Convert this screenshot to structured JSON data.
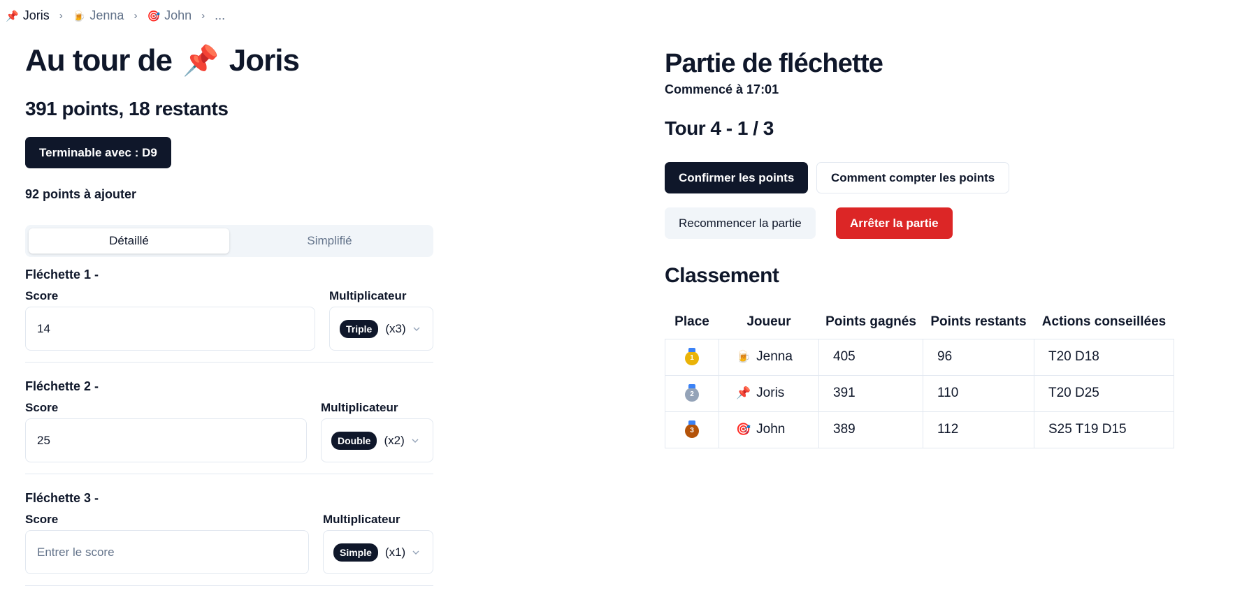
{
  "breadcrumb": [
    {
      "emoji": "📌",
      "name": "Joris",
      "current": true
    },
    {
      "emoji": "🍺",
      "name": "Jenna",
      "current": false
    },
    {
      "emoji": "🎯",
      "name": "John",
      "current": false
    },
    {
      "emoji": "",
      "name": "...",
      "current": false
    }
  ],
  "turn": {
    "prefix": "Au tour de",
    "emoji": "📌",
    "player": "Joris",
    "points_line": "391 points, 18 restants",
    "finish_button": "Terminable avec : D9",
    "to_add": "92 points à ajouter"
  },
  "tabs": [
    {
      "label": "Détaillé",
      "active": true
    },
    {
      "label": "Simplifié",
      "active": false
    }
  ],
  "darts": [
    {
      "title": "Fléchette 1 -",
      "score_label": "Score",
      "mult_label": "Multiplicateur",
      "value": "14",
      "placeholder": "Entrer le score",
      "badge": "Triple",
      "mult": "(x3)"
    },
    {
      "title": "Fléchette 2 -",
      "score_label": "Score",
      "mult_label": "Multiplicateur",
      "value": "25",
      "placeholder": "Entrer le score",
      "badge": "Double",
      "mult": "(x2)"
    },
    {
      "title": "Fléchette 3 -",
      "score_label": "Score",
      "mult_label": "Multiplicateur",
      "value": "",
      "placeholder": "Entrer le score",
      "badge": "Simple",
      "mult": "(x1)"
    }
  ],
  "game": {
    "title": "Partie de fléchette",
    "started": "Commencé à 17:01",
    "round": "Tour 4 - 1 / 3",
    "confirm_button": "Confirmer les points",
    "howto_button": "Comment compter les points",
    "restart_button": "Recommencer la partie",
    "stop_button": "Arrêter la partie"
  },
  "ranking": {
    "title": "Classement",
    "headers": [
      "Place",
      "Joueur",
      "Points gagnés",
      "Points restants",
      "Actions conseillées"
    ],
    "rows": [
      {
        "medal": "1",
        "medal_color": "#eab308",
        "emoji": "🍺",
        "player": "Jenna",
        "gained": "405",
        "remaining": "96",
        "actions": "T20 D18"
      },
      {
        "medal": "2",
        "medal_color": "#94a3b8",
        "emoji": "📌",
        "player": "Joris",
        "gained": "391",
        "remaining": "110",
        "actions": "T20 D25"
      },
      {
        "medal": "3",
        "medal_color": "#b45309",
        "emoji": "🎯",
        "player": "John",
        "gained": "389",
        "remaining": "112",
        "actions": "S25 T19 D15"
      }
    ]
  },
  "colors": {
    "dark": "#0f172a",
    "red": "#dc2626",
    "border": "#e2e8f0",
    "muted": "#64748b"
  }
}
